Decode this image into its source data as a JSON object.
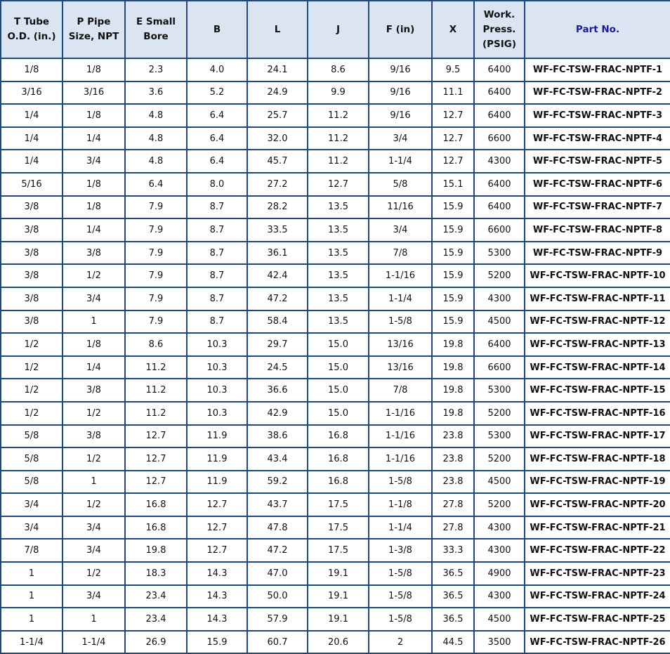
{
  "table": {
    "headers": [
      "T Tube O.D. (in.)",
      "P Pipe Size, NPT",
      "E Small Bore",
      "B",
      "L",
      "J",
      "F (in)",
      "X",
      "Work. Press. (PSIG)",
      "Part No."
    ],
    "header_lines": [
      [
        "T Tube",
        "O.D. (in.)"
      ],
      [
        "P Pipe",
        "Size, NPT"
      ],
      [
        "E Small",
        "Bore"
      ],
      [
        "B"
      ],
      [
        "L"
      ],
      [
        "J"
      ],
      [
        "F (in)"
      ],
      [
        "X"
      ],
      [
        "Work.",
        "Press.",
        "(PSIG)"
      ],
      [
        "Part No."
      ]
    ],
    "rows": [
      [
        "1/8",
        "1/8",
        "2.3",
        "4.0",
        "24.1",
        "8.6",
        "9/16",
        "9.5",
        "6400",
        "WF-FC-TSW-FRAC-NPTF-1"
      ],
      [
        "3/16",
        "3/16",
        "3.6",
        "5.2",
        "24.9",
        "9.9",
        "9/16",
        "11.1",
        "6400",
        "WF-FC-TSW-FRAC-NPTF-2"
      ],
      [
        "1/4",
        "1/8",
        "4.8",
        "6.4",
        "25.7",
        "11.2",
        "9/16",
        "12.7",
        "6400",
        "WF-FC-TSW-FRAC-NPTF-3"
      ],
      [
        "1/4",
        "1/4",
        "4.8",
        "6.4",
        "32.0",
        "11.2",
        "3/4",
        "12.7",
        "6600",
        "WF-FC-TSW-FRAC-NPTF-4"
      ],
      [
        "1/4",
        "3/4",
        "4.8",
        "6.4",
        "45.7",
        "11.2",
        "1-1/4",
        "12.7",
        "4300",
        "WF-FC-TSW-FRAC-NPTF-5"
      ],
      [
        "5/16",
        "1/8",
        "6.4",
        "8.0",
        "27.2",
        "12.7",
        "5/8",
        "15.1",
        "6400",
        "WF-FC-TSW-FRAC-NPTF-6"
      ],
      [
        "3/8",
        "1/8",
        "7.9",
        "8.7",
        "28.2",
        "13.5",
        "11/16",
        "15.9",
        "6400",
        "WF-FC-TSW-FRAC-NPTF-7"
      ],
      [
        "3/8",
        "1/4",
        "7.9",
        "8.7",
        "33.5",
        "13.5",
        "3/4",
        "15.9",
        "6600",
        "WF-FC-TSW-FRAC-NPTF-8"
      ],
      [
        "3/8",
        "3/8",
        "7.9",
        "8.7",
        "36.1",
        "13.5",
        "7/8",
        "15.9",
        "5300",
        "WF-FC-TSW-FRAC-NPTF-9"
      ],
      [
        "3/8",
        "1/2",
        "7.9",
        "8.7",
        "42.4",
        "13.5",
        "1-1/16",
        "15.9",
        "5200",
        "WF-FC-TSW-FRAC-NPTF-10"
      ],
      [
        "3/8",
        "3/4",
        "7.9",
        "8.7",
        "47.2",
        "13.5",
        "1-1/4",
        "15.9",
        "4300",
        "WF-FC-TSW-FRAC-NPTF-11"
      ],
      [
        "3/8",
        "1",
        "7.9",
        "8.7",
        "58.4",
        "13.5",
        "1-5/8",
        "15.9",
        "4500",
        "WF-FC-TSW-FRAC-NPTF-12"
      ],
      [
        "1/2",
        "1/8",
        "8.6",
        "10.3",
        "29.7",
        "15.0",
        "13/16",
        "19.8",
        "6400",
        "WF-FC-TSW-FRAC-NPTF-13"
      ],
      [
        "1/2",
        "1/4",
        "11.2",
        "10.3",
        "24.5",
        "15.0",
        "13/16",
        "19.8",
        "6600",
        "WF-FC-TSW-FRAC-NPTF-14"
      ],
      [
        "1/2",
        "3/8",
        "11.2",
        "10.3",
        "36.6",
        "15.0",
        "7/8",
        "19.8",
        "5300",
        "WF-FC-TSW-FRAC-NPTF-15"
      ],
      [
        "1/2",
        "1/2",
        "11.2",
        "10.3",
        "42.9",
        "15.0",
        "1-1/16",
        "19.8",
        "5200",
        "WF-FC-TSW-FRAC-NPTF-16"
      ],
      [
        "5/8",
        "3/8",
        "12.7",
        "11.9",
        "38.6",
        "16.8",
        "1-1/16",
        "23.8",
        "5300",
        "WF-FC-TSW-FRAC-NPTF-17"
      ],
      [
        "5/8",
        "1/2",
        "12.7",
        "11.9",
        "43.4",
        "16.8",
        "1-1/16",
        "23.8",
        "5200",
        "WF-FC-TSW-FRAC-NPTF-18"
      ],
      [
        "5/8",
        "1",
        "12.7",
        "11.9",
        "59.2",
        "16.8",
        "1-5/8",
        "23.8",
        "4500",
        "WF-FC-TSW-FRAC-NPTF-19"
      ],
      [
        "3/4",
        "1/2",
        "16.8",
        "12.7",
        "43.7",
        "17.5",
        "1-1/8",
        "27.8",
        "5200",
        "WF-FC-TSW-FRAC-NPTF-20"
      ],
      [
        "3/4",
        "3/4",
        "16.8",
        "12.7",
        "47.8",
        "17.5",
        "1-1/4",
        "27.8",
        "4300",
        "WF-FC-TSW-FRAC-NPTF-21"
      ],
      [
        "7/8",
        "3/4",
        "19.8",
        "12.7",
        "47.2",
        "17.5",
        "1-3/8",
        "33.3",
        "4300",
        "WF-FC-TSW-FRAC-NPTF-22"
      ],
      [
        "1",
        "1/2",
        "18.3",
        "14.3",
        "47.0",
        "19.1",
        "1-5/8",
        "36.5",
        "4900",
        "WF-FC-TSW-FRAC-NPTF-23"
      ],
      [
        "1",
        "3/4",
        "23.4",
        "14.3",
        "50.0",
        "19.1",
        "1-5/8",
        "36.5",
        "4300",
        "WF-FC-TSW-FRAC-NPTF-24"
      ],
      [
        "1",
        "1",
        "23.4",
        "14.3",
        "57.9",
        "19.1",
        "1-5/8",
        "36.5",
        "4500",
        "WF-FC-TSW-FRAC-NPTF-25"
      ],
      [
        "1-1/4",
        "1-1/4",
        "26.9",
        "15.9",
        "60.7",
        "20.6",
        "2",
        "44.5",
        "3500",
        "WF-FC-TSW-FRAC-NPTF-26"
      ]
    ]
  },
  "colors": {
    "border": "#1f497d",
    "header_bg": "#dbe5f1",
    "part_header": "#1a1a9c"
  }
}
